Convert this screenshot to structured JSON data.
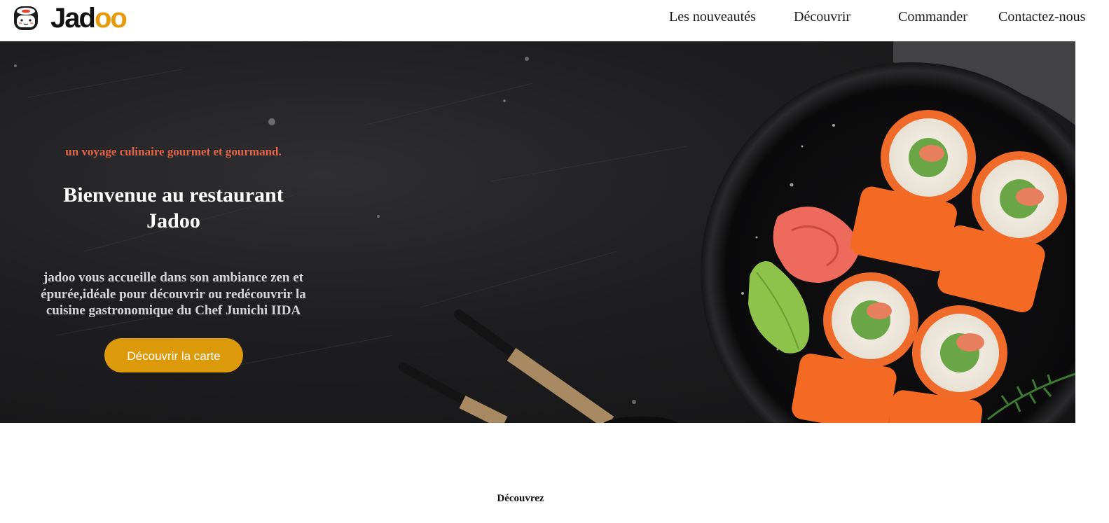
{
  "brand": {
    "name_part1": "Jad",
    "name_part2": "oo",
    "accent_color": "#E59A0B",
    "logo_icon": "sushi-face-logo-icon"
  },
  "nav": {
    "items": [
      {
        "label": "Les nouveautés"
      },
      {
        "label": "Découvrir"
      },
      {
        "label": "Commander"
      },
      {
        "label": "Contactez-nous"
      }
    ]
  },
  "hero": {
    "tagline": "un voyage culinaire gourmet et gourmand.",
    "title": "Bienvenue au restaurant Jadoo",
    "description": "jadoo vous accueille dans son ambiance zen et épurée,idéale pour découvrir ou redécouvrir la cuisine gastronomique du Chef Junichi IIDA",
    "cta_label": "Découvrir la carte",
    "tagline_color": "#E0654A",
    "cta_color": "#DC9A0B",
    "background_image": "sushi-plate-on-dark-stone"
  },
  "section": {
    "heading": "Découvrez"
  }
}
